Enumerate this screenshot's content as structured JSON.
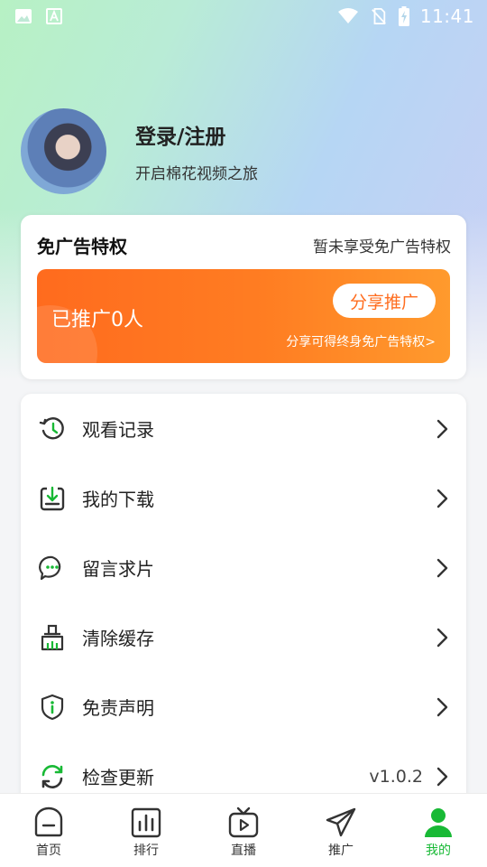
{
  "status_bar": {
    "time": "11:41"
  },
  "profile": {
    "title": "登录/注册",
    "subtitle": "开启棉花视频之旅"
  },
  "ad_card": {
    "title": "免广告特权",
    "status": "暂未享受免广告特权",
    "promoted_count": "已推广0人",
    "share_button": "分享推广",
    "hint": "分享可得终身免广告特权>"
  },
  "menu": [
    {
      "label": "观看记录",
      "icon": "history-icon"
    },
    {
      "label": "我的下载",
      "icon": "download-icon"
    },
    {
      "label": "留言求片",
      "icon": "message-icon"
    },
    {
      "label": "清除缓存",
      "icon": "broom-icon"
    },
    {
      "label": "免责声明",
      "icon": "shield-icon"
    },
    {
      "label": "检查更新",
      "icon": "refresh-icon",
      "value": "v1.0.2"
    }
  ],
  "nav": [
    {
      "label": "首页",
      "icon": "home-icon"
    },
    {
      "label": "排行",
      "icon": "ranking-icon"
    },
    {
      "label": "直播",
      "icon": "tv-icon"
    },
    {
      "label": "推广",
      "icon": "send-icon"
    },
    {
      "label": "我的",
      "icon": "user-icon",
      "active": true
    }
  ],
  "colors": {
    "accent": "#18b935",
    "orange": "#ff6d1f"
  }
}
